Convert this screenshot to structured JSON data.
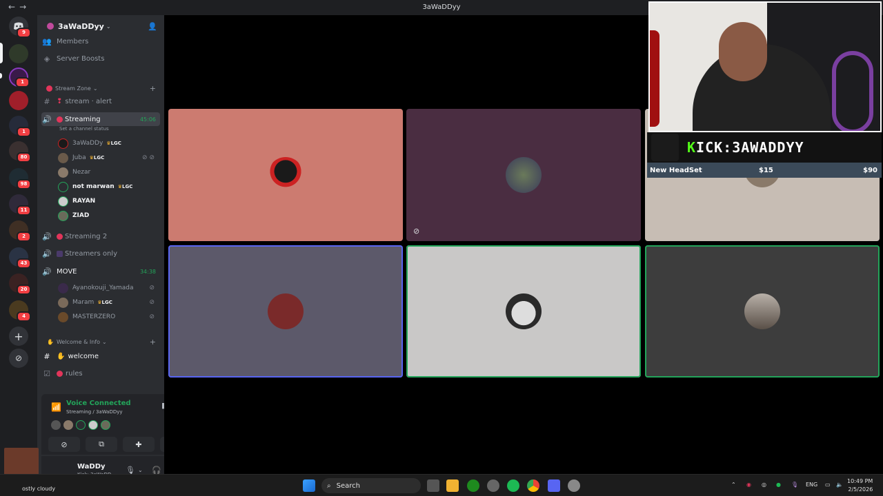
{
  "window": {
    "title": "3aWaDDyy",
    "back": "←",
    "forward": "→"
  },
  "rail": {
    "badges": [
      "9",
      "1",
      "1",
      "80",
      "98",
      "11",
      "2",
      "43",
      "20",
      "4"
    ]
  },
  "server": {
    "name": "3aWaDDyy",
    "invite_icon": "add-member-icon"
  },
  "sidebar": {
    "members": "Members",
    "boosts": "Server Boosts",
    "cat_stream": "Stream Zone",
    "stream_alert": "stream · alert",
    "streaming": "Streaming",
    "streaming_time": "45:06",
    "status_hint": "Set a channel status",
    "streaming2": "Streaming 2",
    "streamers_only": "Streamers only",
    "move": "MOVE",
    "move_time": "34:38",
    "cat_welcome": "Welcome & Info",
    "welcome": "welcome",
    "rules": "rules"
  },
  "members": [
    {
      "name": "3aWaDDy",
      "tag": "LGC"
    },
    {
      "name": "Juba",
      "tag": "LGC"
    },
    {
      "name": "Nezar",
      "tag": ""
    },
    {
      "name": "not marwan",
      "tag": "LGC"
    },
    {
      "name": "RAYAN",
      "tag": ""
    },
    {
      "name": "ZIAD",
      "tag": ""
    }
  ],
  "move_members": [
    {
      "name": "Ayanokouji_Yamada",
      "tag": ""
    },
    {
      "name": "Maram",
      "tag": "LGC"
    },
    {
      "name": "MASTERZERO",
      "tag": ""
    }
  ],
  "voice": {
    "status": "Voice Connected",
    "channel": "Streaming / 3aWaDDyy"
  },
  "user": {
    "name": "WaDDy",
    "status": "Kick: 3aWaDD..."
  },
  "overlay": {
    "kick_prefix": "K",
    "kick_text": "ICK:3AWADDYY",
    "item": "New HeadSet",
    "price1": "$15",
    "price2": "$90"
  },
  "taskbar": {
    "search": "Search",
    "lang": "ENG",
    "time": "10:49 PM",
    "date": "2/5/2026",
    "weather": "ostly cloudy"
  },
  "colors": {
    "accent": "#5865f2",
    "online": "#23a55a",
    "kick": "#53fc18"
  }
}
